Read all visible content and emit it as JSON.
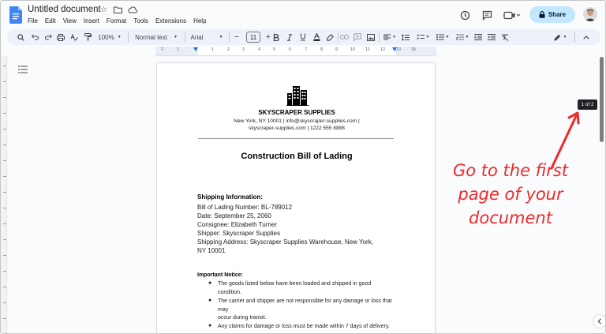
{
  "header": {
    "title": "Untitled document",
    "menu": [
      "File",
      "Edit",
      "View",
      "Insert",
      "Format",
      "Tools",
      "Extensions",
      "Help"
    ],
    "share_label": "Share"
  },
  "toolbar": {
    "zoom": "100%",
    "style": "Normal text",
    "font": "Arial",
    "font_size": "11"
  },
  "ruler": {
    "numbers": [
      "2",
      "1",
      "1",
      "2",
      "3",
      "4",
      "5",
      "6",
      "7",
      "8",
      "9",
      "10",
      "11",
      "12",
      "13",
      "15"
    ]
  },
  "document": {
    "company_name": "SKYSCRAPER SUPPLIES",
    "company_line1": "New York, NY 10001 | info@skyscraper-supplies.com |",
    "company_line2": "skyscraper-supplies.com | 1222 555 8888",
    "heading": "Construction Bill of Lading",
    "shipping_head": "Shipping Information:",
    "shipping_lines": [
      "Bill of Lading Number: BL-789012",
      "Date: September 25, 2060",
      "Consignee: Elizabeth Turner",
      "Shipper: Skyscraper Supplies",
      "Shipping Address: Skyscraper Supplies Warehouse, New York,",
      "NY 10001"
    ],
    "notice_head": "Important Notice:",
    "notice_bullets": [
      "The goods listed below have been loaded and shipped in good condition.",
      "The carrier and shipper are not responsible for any damage or loss that may",
      "occur during transit.",
      "Any claims for damage or loss must be made within 7 days of delivery."
    ]
  },
  "page_indicator": "1 of 2",
  "annotation": {
    "lines": [
      "Go to the first",
      "page of your",
      "document"
    ],
    "color": "#ef2a2a"
  },
  "colors": {
    "share_bg": "#c2e7ff",
    "toolbar_bg": "#edf2fa",
    "accent": "#1a73e8"
  }
}
